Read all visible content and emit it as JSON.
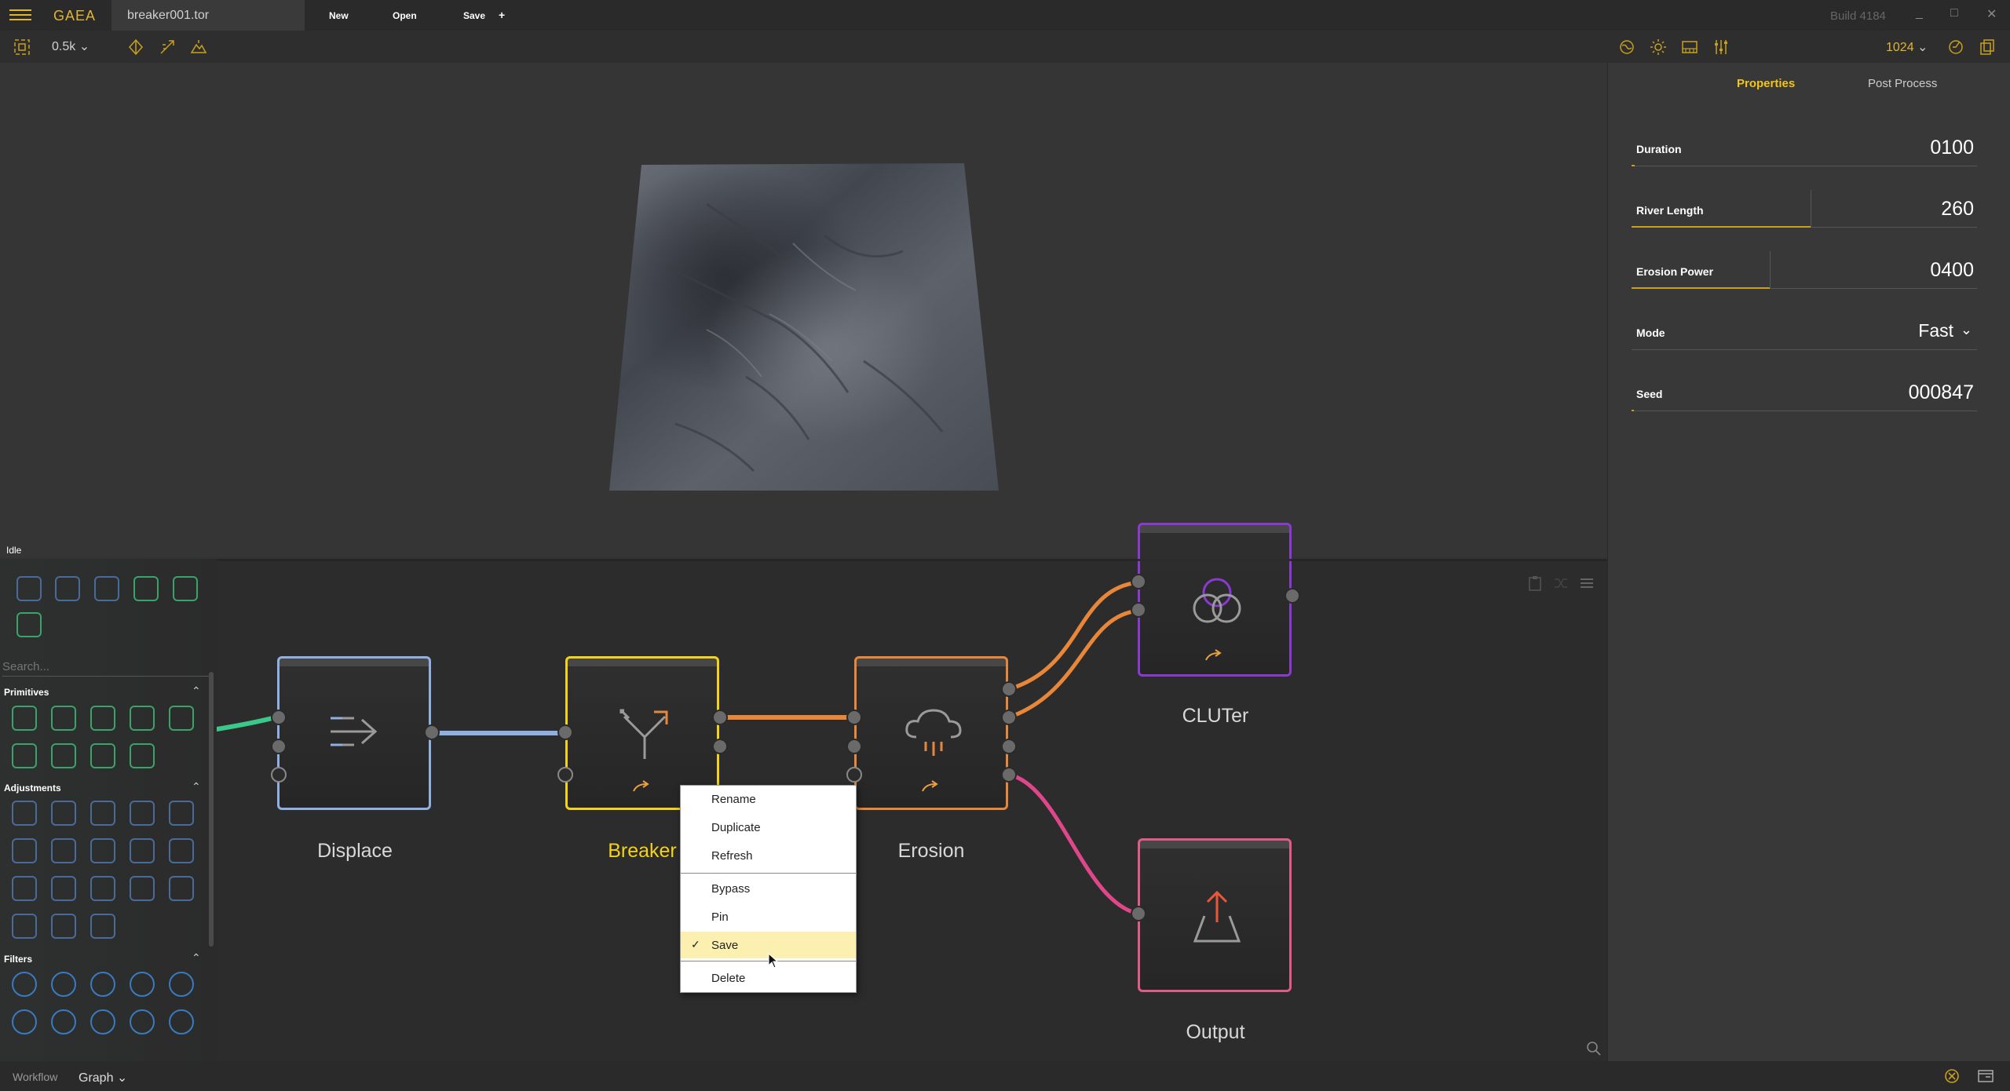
{
  "app": {
    "logo": "GAEA",
    "file_tab": "breaker001.tor",
    "menu": {
      "new": "New",
      "open": "Open",
      "save": "Save",
      "add": "+"
    },
    "build": "Build 4184",
    "window": {
      "minimize": "_",
      "maximize": "□",
      "close": "✕"
    }
  },
  "toolbar": {
    "resolution": "0.5k",
    "build_resolution": "1024"
  },
  "status": {
    "text": "Idle"
  },
  "properties": {
    "tabs": {
      "properties": "Properties",
      "post_process": "Post Process"
    },
    "fields": [
      {
        "label": "Duration",
        "value": "0100",
        "level": 0.01
      },
      {
        "label": "River Length",
        "value": "260",
        "level": 0.52
      },
      {
        "label": "Erosion Power",
        "value": "0400",
        "level": 0.4
      },
      {
        "label": "Mode",
        "value": "Fast"
      },
      {
        "label": "Seed",
        "value": "000847",
        "level": 0.01
      }
    ]
  },
  "palette": {
    "search_placeholder": "Search...",
    "sections": {
      "primitives": "Primitives",
      "adjustments": "Adjustments",
      "filters": "Filters"
    }
  },
  "nodes": {
    "displace": {
      "label": "Displace",
      "color": "#8fb0e0"
    },
    "breaker": {
      "label": "Breaker",
      "color": "#f2d21a"
    },
    "erosion": {
      "label": "Erosion",
      "color": "#e8873a"
    },
    "cluter": {
      "label": "CLUTer",
      "color": "#8a3ad0"
    },
    "output": {
      "label": "Output",
      "color": "#e05a8a"
    }
  },
  "context_menu": {
    "items": {
      "rename": "Rename",
      "duplicate": "Duplicate",
      "refresh": "Refresh",
      "bypass": "Bypass",
      "pin": "Pin",
      "save": "Save",
      "delete": "Delete"
    },
    "checked": "✓"
  },
  "bottom": {
    "workflow": "Workflow",
    "view": "Graph"
  }
}
